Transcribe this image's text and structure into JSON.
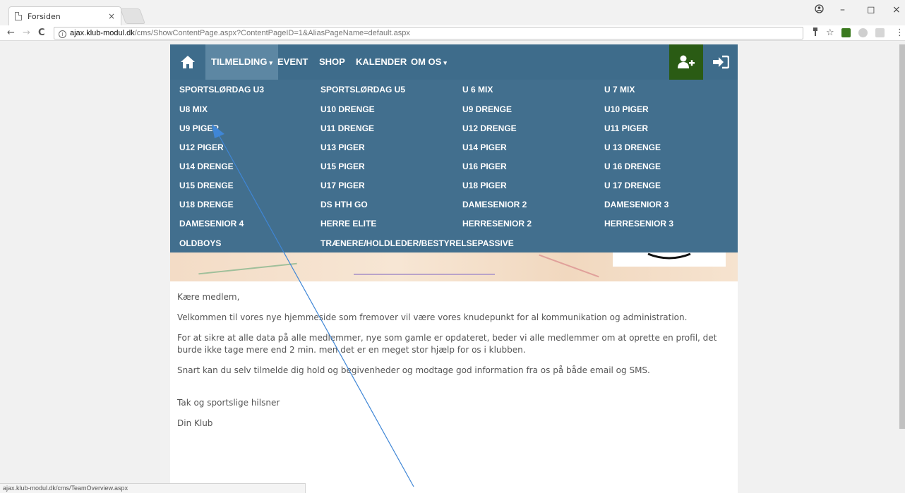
{
  "browser": {
    "tab_title": "Forsiden",
    "tab_close": "×",
    "url_host": "ajax.klub-modul.dk",
    "url_path": "/cms/ShowContentPage.aspx?ContentPageID=1&AliasPageName=default.aspx",
    "status_url": "ajax.klub-modul.dk/cms/TeamOverview.aspx",
    "back": "←",
    "forward": "→",
    "reload": "C",
    "minimize": "–",
    "restore": "◻",
    "close": "×"
  },
  "nav": {
    "items": [
      {
        "label": "TILMELDING",
        "has_dropdown": true,
        "active": true
      },
      {
        "label": "EVENT"
      },
      {
        "label": "SHOP"
      },
      {
        "label": "KALENDER"
      },
      {
        "label": "OM OS",
        "has_dropdown": true
      }
    ],
    "chevron": "⌄",
    "colors": {
      "bar": "#3e6c8b",
      "active": "#5d87a3",
      "adduser": "#2a5b14",
      "dropdown": "#426f8e"
    }
  },
  "dropdown": {
    "columns": [
      [
        "SPORTSLØRDAG U3",
        "U8 MIX",
        "U9 PIGER",
        "U12 PIGER",
        "U14 DRENGE",
        "U15 DRENGE",
        "U18 DRENGE",
        "DAMESENIOR 4",
        "OLDBOYS"
      ],
      [
        "SPORTSLØRDAG U5",
        "U10 DRENGE",
        "U11 DRENGE",
        "U13 PIGER",
        "U15 PIGER",
        "U17 PIGER",
        "DS HTH GO",
        "HERRE ELITE",
        "TRÆNERE/HOLDLEDER/BESTYRELSEPASSIVE"
      ],
      [
        "U 6 MIX",
        "U9 DRENGE",
        "U12 DRENGE",
        "U14 PIGER",
        "U16 PIGER",
        "U18 PIGER",
        "DAMESENIOR 2",
        "HERRESENIOR 2"
      ],
      [
        "U 7 MIX",
        "U10 PIGER",
        "U11 PIGER",
        "U 13 DRENGE",
        "U 16 DRENGE",
        "U 17 DRENGE",
        "DAMESENIOR 3",
        "HERRESENIOR 3"
      ]
    ]
  },
  "content": {
    "paragraphs": [
      "Kære medlem,",
      "Velkommen til vores nye hjemmeside som fremover vil være vores knudepunkt for al kommunikation og administration.",
      "For at sikre at alle data på alle medlemmer, nye som gamle er opdateret, beder vi alle medlemmer om at oprette en profil, det burde ikke tage mere end 2 min. men det er en meget stor hjælp for os i klubben.",
      "Snart kan du selv tilmelde dig hold og begivenheder og modtage god information fra os på både email og SMS.",
      "",
      "Tak og sportslige hilsner",
      "Din Klub"
    ]
  }
}
